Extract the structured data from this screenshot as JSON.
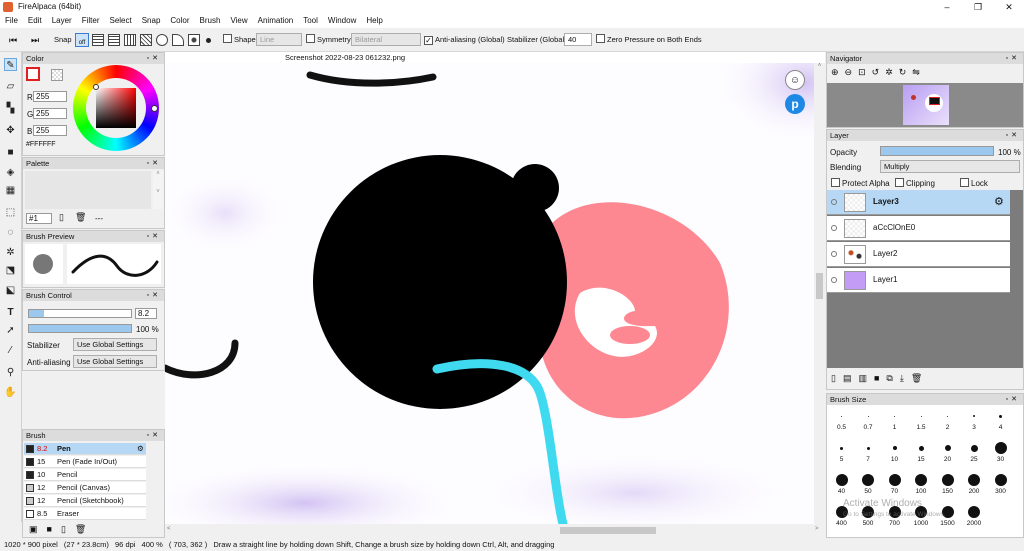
{
  "window": {
    "title": "FireAlpaca (64bit)",
    "minimize": "–",
    "maximize": "❐",
    "close": "✕"
  },
  "menu": [
    "File",
    "Edit",
    "Layer",
    "Filter",
    "Select",
    "Snap",
    "Color",
    "Brush",
    "View",
    "Animation",
    "Tool",
    "Window",
    "Help"
  ],
  "toolbar": {
    "snap_label": "Snap",
    "snap_off": "off",
    "shape_label": "Shape",
    "shape_value": "Line",
    "symmetry_label": "Symmetry",
    "symmetry_value": "Bilateral",
    "antialiasing_label": "Anti-aliasing (Global)",
    "stabilizer_label": "Stabilizer (Global)",
    "stabilizer_value": "40",
    "zero_pressure_label": "Zero Pressure on Both Ends"
  },
  "color_panel": {
    "title": "Color",
    "r_label": "R",
    "g_label": "G",
    "b_label": "B",
    "r": "255",
    "g": "255",
    "b": "255",
    "hex": "#FFFFFF"
  },
  "palette_panel": {
    "title": "Palette",
    "selector": "#1",
    "more": "---"
  },
  "brush_preview": {
    "title": "Brush Preview"
  },
  "brush_control": {
    "title": "Brush Control",
    "size": "8.2",
    "opacity": "100 %",
    "stabilizer_label": "Stabilizer",
    "stabilizer_value": "Use Global Settings",
    "antialiasing_label": "Anti-aliasing",
    "antialiasing_value": "Use Global Settings"
  },
  "brush_panel": {
    "title": "Brush",
    "items": [
      {
        "size": "8.2",
        "name": "Pen",
        "color": "#222222"
      },
      {
        "size": "15",
        "name": "Pen (Fade In/Out)",
        "color": "#222222"
      },
      {
        "size": "10",
        "name": "Pencil",
        "color": "#222222"
      },
      {
        "size": "12",
        "name": "Pencil (Canvas)",
        "color": "#cccccc"
      },
      {
        "size": "12",
        "name": "Pencil (Sketchbook)",
        "color": "#cccccc"
      },
      {
        "size": "8.5",
        "name": "Eraser",
        "color": "#ffffff"
      }
    ]
  },
  "document": {
    "tab": "Screenshot 2022-08-23 061232.png"
  },
  "navigator": {
    "title": "Navigator"
  },
  "layer_panel": {
    "title": "Layer",
    "opacity_label": "Opacity",
    "opacity_value": "100 %",
    "opacity_fraction": 1.0,
    "blending_label": "Blending",
    "blending_value": "Multiply",
    "protect_alpha": "Protect Alpha",
    "clipping": "Clipping",
    "lock": "Lock",
    "layers": [
      {
        "name": "Layer3",
        "active": true
      },
      {
        "name": "aCcClOnE0",
        "active": false
      },
      {
        "name": "Layer2",
        "active": false
      },
      {
        "name": "Layer1",
        "active": false
      }
    ]
  },
  "brush_size": {
    "title": "Brush Size",
    "sizes": [
      "0.5",
      "0.7",
      "1",
      "1.5",
      "2",
      "3",
      "4",
      "5",
      "7",
      "10",
      "15",
      "20",
      "25",
      "30",
      "40",
      "50",
      "70",
      "100",
      "150",
      "200",
      "300",
      "400",
      "500",
      "700",
      "1000",
      "1500",
      "2000"
    ]
  },
  "watermark": {
    "line1": "Activate Windows",
    "line2": "Go to Settings to activate Windows."
  },
  "status": {
    "size": "1020 * 900 pixel",
    "physical": "(27 * 23.8cm)",
    "dpi": "96 dpi",
    "zoom": "400 %",
    "cursor": "( 703, 362 )",
    "hint": "Draw a straight line by holding down Shift, Change a brush size by holding down Ctrl, Alt, and dragging"
  }
}
